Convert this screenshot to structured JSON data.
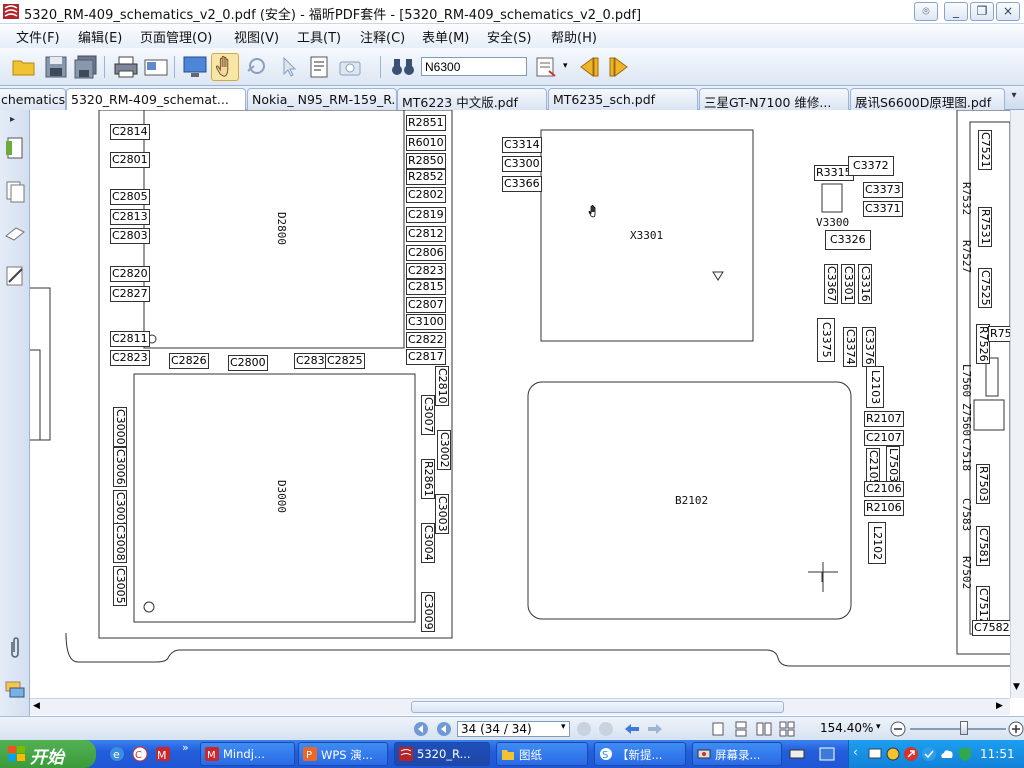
{
  "window": {
    "title": "5320_RM-409_schematics_v2_0.pdf (安全) - 福昕PDF套件 - [5320_RM-409_schematics_v2_0.pdf]",
    "buttons": [
      "⌾",
      "_",
      "❐",
      "×"
    ]
  },
  "menu": [
    "文件(F)",
    "编辑(E)",
    "页面管理(O)",
    "视图(V)",
    "工具(T)",
    "注释(C)",
    "表单(M)",
    "安全(S)",
    "帮助(H)"
  ],
  "toolbar": {
    "search_value": "N6300"
  },
  "tabs": [
    {
      "label": "chematics...",
      "active": false
    },
    {
      "label": "5320_RM-409_schemat...",
      "active": true
    },
    {
      "label": "Nokia_ N95_RM-159_R...",
      "active": false
    },
    {
      "label": "MT6223 中文版.pdf",
      "active": false
    },
    {
      "label": "MT6235_sch.pdf",
      "active": false
    },
    {
      "label": "三星GT-N7100 维修...",
      "active": false
    },
    {
      "label": "展讯S6600D原理图.pdf",
      "active": false
    }
  ],
  "status": {
    "page": "34 (34 / 34)",
    "zoom": "154.40%"
  },
  "schematic": {
    "chips": [
      "D2800",
      "D3000",
      "X3301",
      "B2102",
      "V3300"
    ],
    "labels_left": [
      "C2814",
      "C2801",
      "C2805",
      "C2813",
      "C2803",
      "C2820",
      "C2827",
      "C2811",
      "C2823"
    ],
    "labels_right": [
      "R2851",
      "R6010",
      "R2850",
      "R2852",
      "C2802",
      "C2819",
      "C2812",
      "C2806",
      "C2823",
      "C2815",
      "C2807",
      "C3100",
      "C2822",
      "C2817"
    ],
    "labels_bottom_row": [
      "C2826",
      "C2800",
      "C2831",
      "C2825"
    ],
    "labels_d3000_left": [
      "C3000",
      "C3006",
      "C3001",
      "C3008",
      "C3005"
    ],
    "labels_d3000_right": [
      "C2810",
      "C3007",
      "C3002",
      "R2861",
      "C3003",
      "C3004",
      "C3009"
    ],
    "labels_x3301": [
      "C3314",
      "C3300",
      "C3366"
    ],
    "labels_v3300": [
      "R3315",
      "C3372",
      "C3373",
      "C3371",
      "C3326"
    ],
    "labels_mid": [
      "C3367",
      "C3301",
      "C3316",
      "C3375",
      "C3374",
      "C3376"
    ],
    "labels_b2102": [
      "L2103",
      "R2107",
      "C2107",
      "C2105",
      "L7503",
      "C2106",
      "R2106",
      "L2102"
    ],
    "labels_far_right": [
      "C7521",
      "R7532",
      "R7531",
      "R7527",
      "C7525",
      "R7526",
      "R753",
      "L7560",
      "Z7560",
      "C7518",
      "R7503",
      "C7583",
      "C7581",
      "R7502",
      "C7517",
      "C7582"
    ]
  },
  "taskbar": {
    "start": "开始",
    "items": [
      "Mindj...",
      "WPS 演...",
      "5320_R...",
      "图纸",
      "【新提...",
      "屏幕录..."
    ],
    "clock": "11:51"
  }
}
